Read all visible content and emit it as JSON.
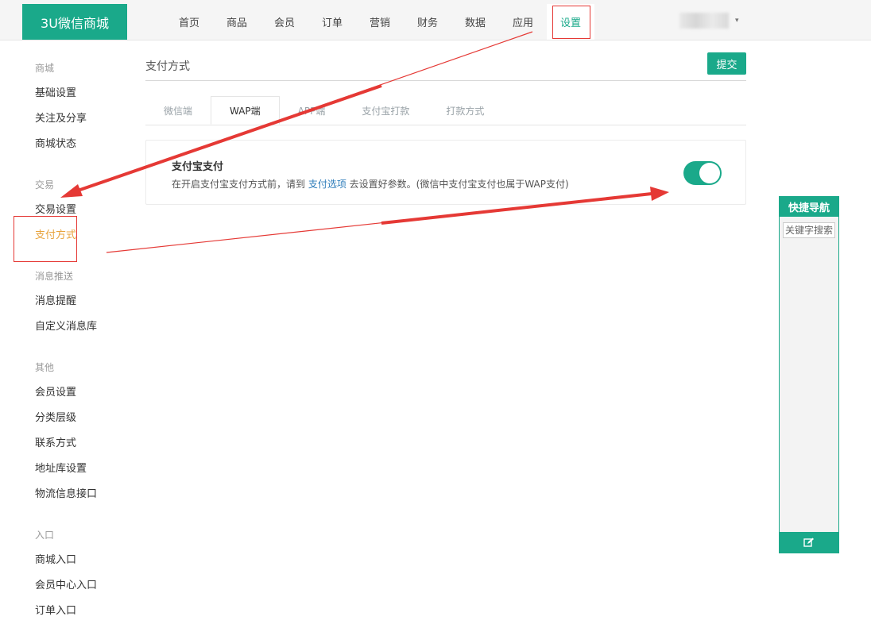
{
  "header": {
    "brand": "3U微信商城",
    "nav": [
      "首页",
      "商品",
      "会员",
      "订单",
      "营销",
      "财务",
      "数据",
      "应用",
      "设置"
    ],
    "user_caret": "▾"
  },
  "sidebar": {
    "groups": [
      {
        "title": "商城",
        "items": [
          "基础设置",
          "关注及分享",
          "商城状态"
        ]
      },
      {
        "title": "交易",
        "items": [
          "交易设置",
          "支付方式"
        ]
      },
      {
        "title": "消息推送",
        "items": [
          "消息提醒",
          "自定义消息库"
        ]
      },
      {
        "title": "其他",
        "items": [
          "会员设置",
          "分类层级",
          "联系方式",
          "地址库设置",
          "物流信息接口"
        ]
      },
      {
        "title": "入口",
        "items": [
          "商城入口",
          "会员中心入口",
          "订单入口"
        ]
      }
    ]
  },
  "main": {
    "title": "支付方式",
    "submit_label": "提交",
    "tabs": [
      "微信端",
      "WAP端",
      "APP端",
      "支付宝打款",
      "打款方式"
    ],
    "card": {
      "title": "支付宝支付",
      "desc_before": "在开启支付宝支付方式前，请到 ",
      "desc_link": "支付选项",
      "desc_after": " 去设置好参数。(微信中支付宝支付也属于WAP支付)",
      "toggle_on": true
    }
  },
  "quick_nav": {
    "title": "快捷导航",
    "search_placeholder": "关键字搜索",
    "edit_icon": "edit-icon"
  },
  "colors": {
    "brand": "#1aa98a",
    "active_side": "#e8a33c",
    "link": "#2b7bb9",
    "annotation": "#e53935"
  }
}
